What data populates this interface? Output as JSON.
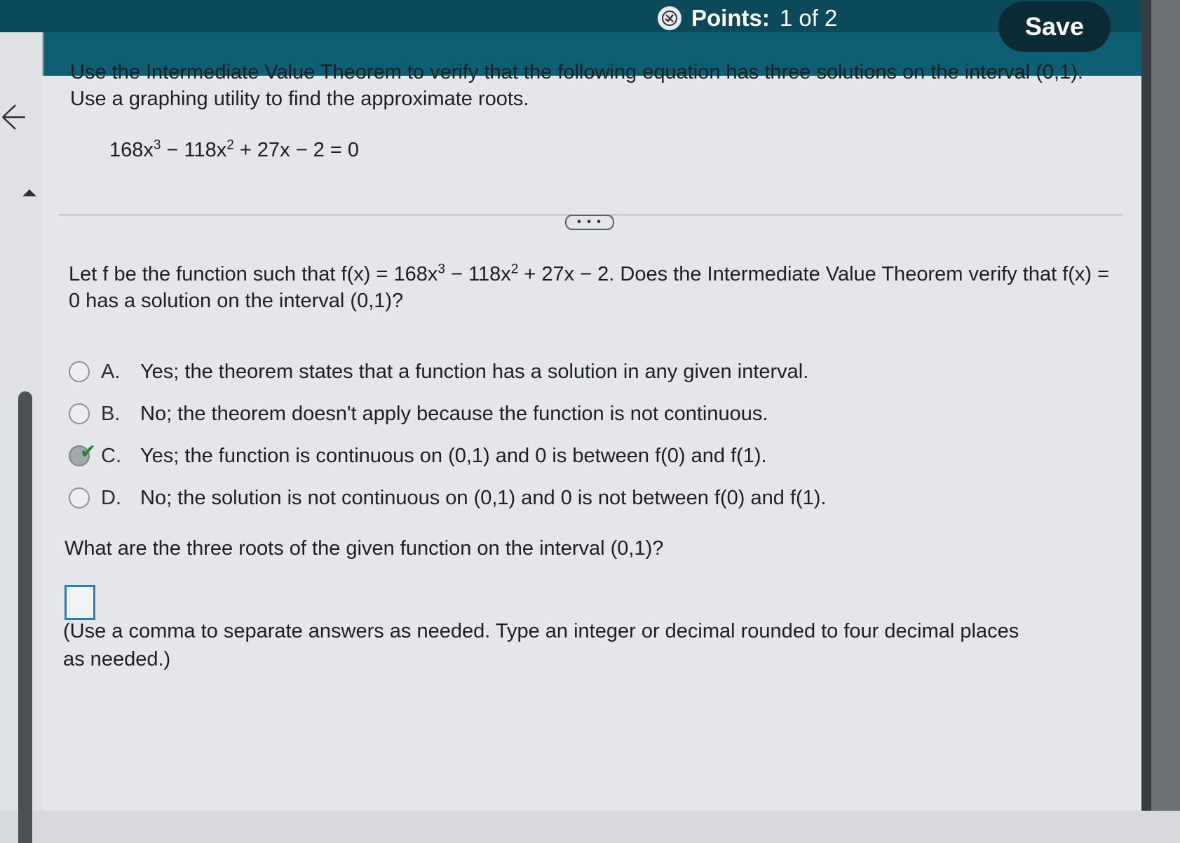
{
  "header": {
    "points_label": "Points:",
    "points_value": "1 of 2",
    "save_label": "Save"
  },
  "problem": {
    "prompt": "Use the Intermediate Value Theorem to verify that the following equation has three solutions on the interval (0,1). Use a graphing utility to find the approximate roots.",
    "equation": {
      "t1": "168x",
      "e1": "3",
      "t2": " − 118x",
      "e2": "2",
      "t3": " + 27x − 2 = 0"
    }
  },
  "more_label": "• • •",
  "part1": {
    "q_start": "Let f be the function such that f(x) = 168x",
    "e1": "3",
    "q_mid": " − 118x",
    "e2": "2",
    "q_end": " + 27x − 2. Does the Intermediate Value Theorem verify that f(x) = 0 has a solution on the interval (0,1)?",
    "options": [
      {
        "letter": "A.",
        "text": "Yes; the theorem states that a function has a solution in any given interval.",
        "selected": false
      },
      {
        "letter": "B.",
        "text": "No; the theorem doesn't apply because the function is not continuous.",
        "selected": false
      },
      {
        "letter": "C.",
        "text": "Yes; the function is continuous on (0,1) and 0 is between f(0) and f(1).",
        "selected": true
      },
      {
        "letter": "D.",
        "text": "No; the solution is not continuous on (0,1) and 0 is not between f(0) and f(1).",
        "selected": false
      }
    ]
  },
  "part2": {
    "question": "What are the three roots of the given function on the interval (0,1)?",
    "answer_value": "",
    "hint": "(Use a comma to separate answers as needed. Type an integer or decimal rounded to four decimal places as needed.)"
  },
  "colors": {
    "header": "#0f5f74",
    "save_button": "#0c2a33",
    "correct": "#1f8a3a",
    "answer_border": "#2b7bbf"
  }
}
